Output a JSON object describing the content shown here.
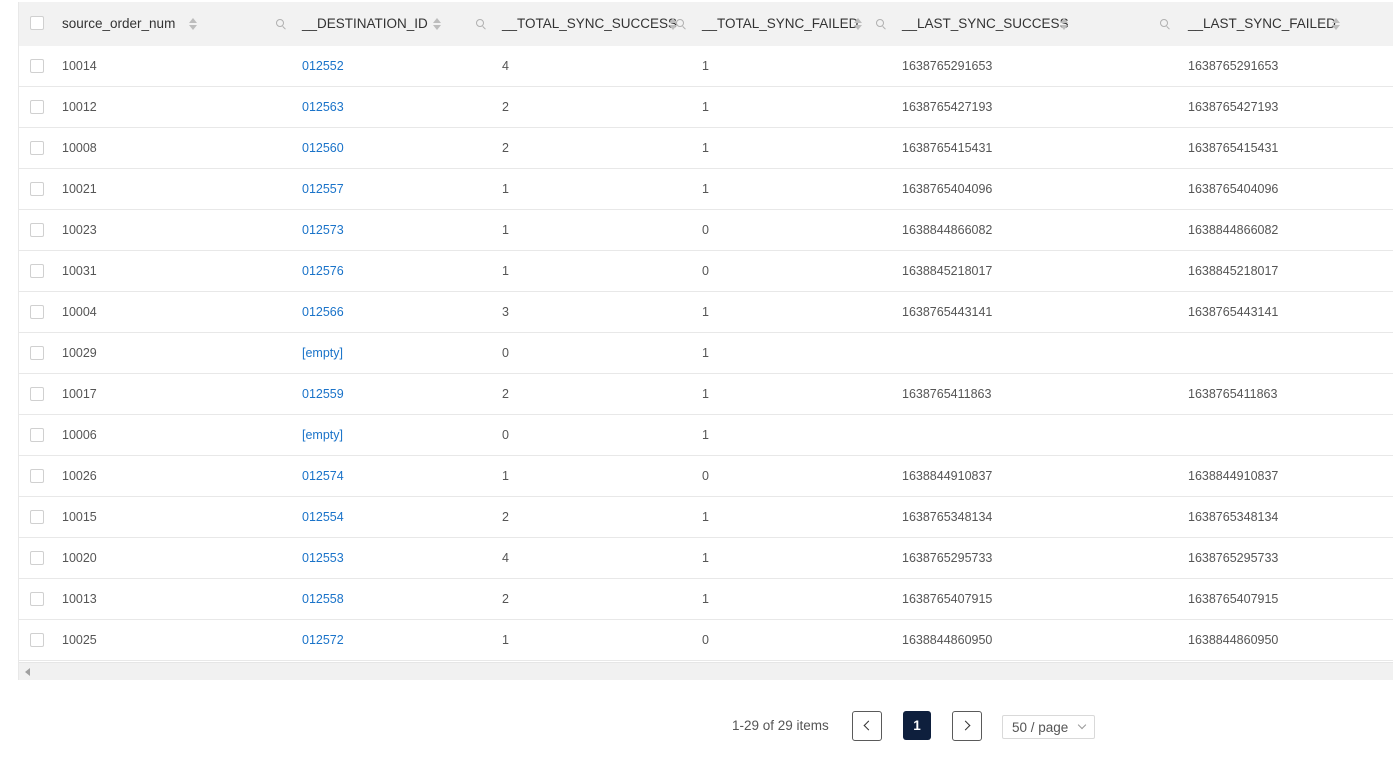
{
  "table": {
    "columns": [
      {
        "label": "source_order_num"
      },
      {
        "label": "__DESTINATION_ID"
      },
      {
        "label": "__TOTAL_SYNC_SUCCESS"
      },
      {
        "label": "__TOTAL_SYNC_FAILED"
      },
      {
        "label": "__LAST_SYNC_SUCCESS"
      },
      {
        "label": "__LAST_SYNC_FAILED"
      }
    ],
    "rows": [
      [
        "10014",
        "012552",
        "4",
        "1",
        "1638765291653",
        "1638765291653"
      ],
      [
        "10012",
        "012563",
        "2",
        "1",
        "1638765427193",
        "1638765427193"
      ],
      [
        "10008",
        "012560",
        "2",
        "1",
        "1638765415431",
        "1638765415431"
      ],
      [
        "10021",
        "012557",
        "1",
        "1",
        "1638765404096",
        "1638765404096"
      ],
      [
        "10023",
        "012573",
        "1",
        "0",
        "1638844866082",
        "1638844866082"
      ],
      [
        "10031",
        "012576",
        "1",
        "0",
        "1638845218017",
        "1638845218017"
      ],
      [
        "10004",
        "012566",
        "3",
        "1",
        "1638765443141",
        "1638765443141"
      ],
      [
        "10029",
        "[empty]",
        "0",
        "1",
        "",
        ""
      ],
      [
        "10017",
        "012559",
        "2",
        "1",
        "1638765411863",
        "1638765411863"
      ],
      [
        "10006",
        "[empty]",
        "0",
        "1",
        "",
        ""
      ],
      [
        "10026",
        "012574",
        "1",
        "0",
        "1638844910837",
        "1638844910837"
      ],
      [
        "10015",
        "012554",
        "2",
        "1",
        "1638765348134",
        "1638765348134"
      ],
      [
        "10020",
        "012553",
        "4",
        "1",
        "1638765295733",
        "1638765295733"
      ],
      [
        "10013",
        "012558",
        "2",
        "1",
        "1638765407915",
        "1638765407915"
      ],
      [
        "10025",
        "012572",
        "1",
        "0",
        "1638844860950",
        "1638844860950"
      ]
    ]
  },
  "pagination": {
    "total_label": "1-29 of 29 items",
    "current_page": "1",
    "page_size": "50 / page"
  },
  "icons": {
    "sort": "sort-icon",
    "search": "search-icon",
    "prev": "chevron-left-icon",
    "next": "chevron-right-icon",
    "dropdown": "chevron-down-icon",
    "scroll_left": "scroll-left-arrow-icon"
  },
  "colors": {
    "link": "#1a73c9",
    "header_bg": "#f2f2f2",
    "active_page": "#0e1f3d"
  }
}
